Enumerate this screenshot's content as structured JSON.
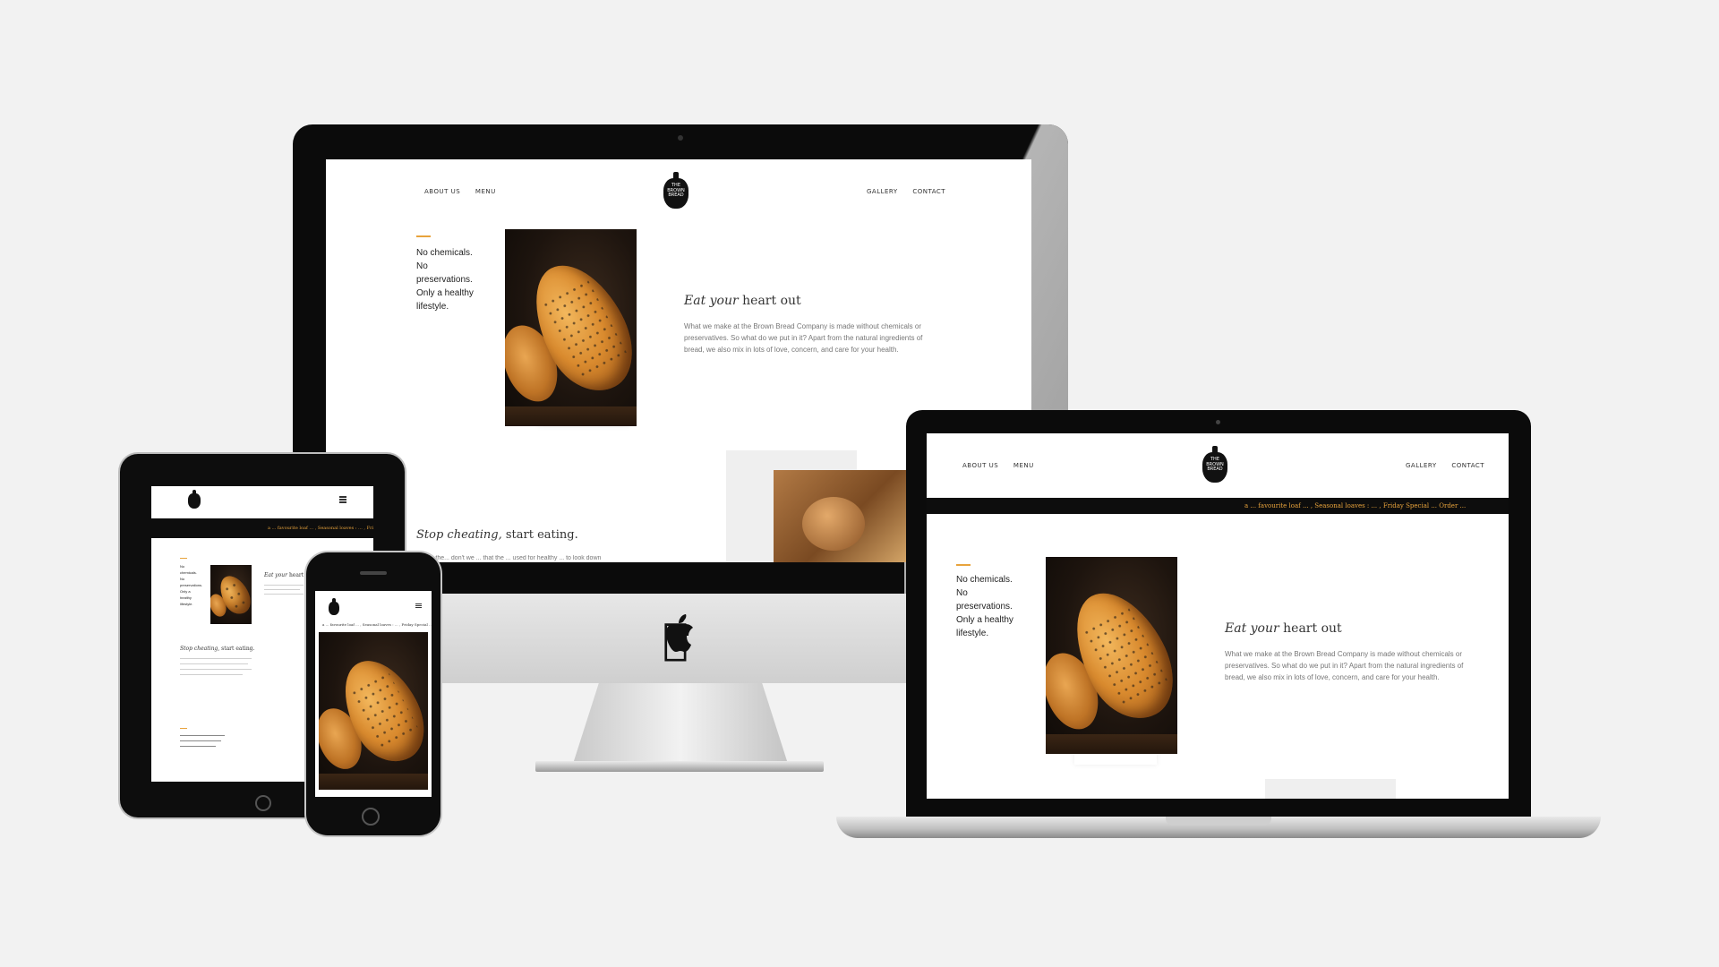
{
  "site": {
    "nav_left": [
      "ABOUT US",
      "MENU"
    ],
    "nav_right": [
      "GALLERY",
      "CONTACT"
    ],
    "logo_lines": [
      "THE",
      "BROWN",
      "BREAD"
    ],
    "tagline": "No chemicals. No preservations. Only a healthy lifestyle.",
    "headline_italic": "Eat your",
    "headline_rest": "heart out",
    "body": "What we make at the Brown Bread Company is made without chemicals or preservatives. So what do we put in it? Apart from the natural ingredients of bread, we also mix in lots of love, concern, and care for your health.",
    "headline2_italic": "Stop cheating,",
    "headline2_rest": "start eating.",
    "body2": "Unlike the... don't we ... that the ... used for healthy ... to look down"
  },
  "laptop": {
    "banner": "a ... favourite loaf ... , Seasonal loaves : ... , Friday Special ... Order ..."
  },
  "colors": {
    "accent": "#e8a33c",
    "bezel": "#0b0b0b",
    "background": "#f2f2f2"
  },
  "icons": {
    "imac_logo": "apple-icon"
  }
}
